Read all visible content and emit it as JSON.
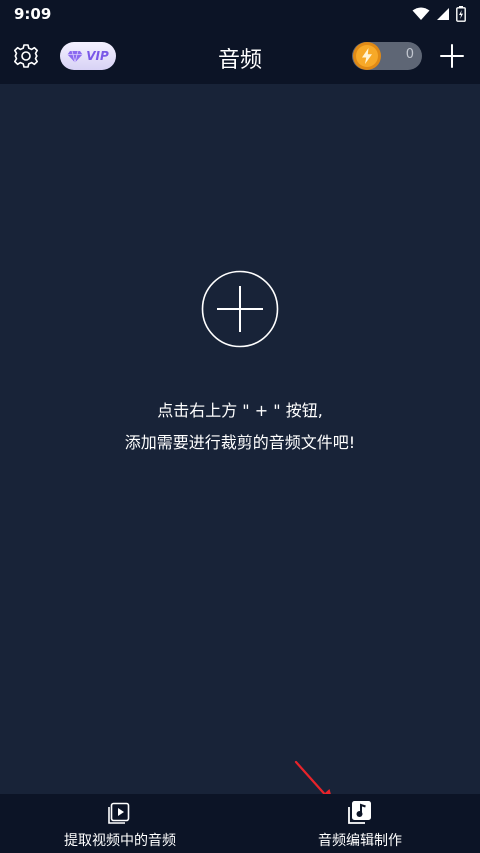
{
  "status_bar": {
    "time": "9:09",
    "icons": [
      "wifi-icon",
      "signal-icon",
      "battery-icon"
    ]
  },
  "header": {
    "title": "音频",
    "vip_label": "VIP",
    "credit_count": "0",
    "icons": [
      "gear-icon",
      "diamond-icon",
      "lightning-coin-icon",
      "plus-icon"
    ]
  },
  "main": {
    "hint_line1": "点击右上方 \" + \" 按钮,",
    "hint_line2": "添加需要进行裁剪的音频文件吧!",
    "icons": [
      "circle-plus-icon",
      "red-arrow-icon"
    ]
  },
  "bottom_nav": {
    "tabs": [
      {
        "label": "提取视频中的音频",
        "icon": "video-play-icon"
      },
      {
        "label": "音频编辑制作",
        "icon": "music-stack-icon"
      }
    ]
  },
  "colors": {
    "background": "#182338",
    "bar_background": "#0c1426",
    "vip_accent": "#7a58e8",
    "coin": "#f5a623",
    "arrow": "#e8232a"
  }
}
